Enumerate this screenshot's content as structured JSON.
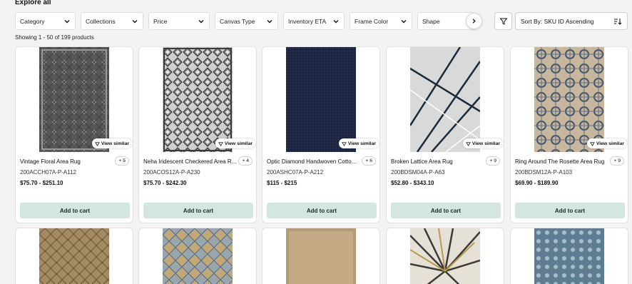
{
  "page": {
    "title": "Explore all",
    "count_text": "Showing 1 - 50 of 199 products"
  },
  "filters": [
    {
      "label": "Category",
      "name": "filter-category"
    },
    {
      "label": "Collections",
      "name": "filter-collections"
    },
    {
      "label": "Price",
      "name": "filter-price"
    },
    {
      "label": "Canvas Type",
      "name": "filter-canvas-type"
    },
    {
      "label": "Inventory ETA",
      "name": "filter-inventory-eta"
    },
    {
      "label": "Frame Color",
      "name": "filter-frame-color"
    },
    {
      "label": "Shape",
      "name": "filter-shape"
    }
  ],
  "sort": {
    "label": "Sort By: SKU ID Ascending"
  },
  "card_actions": {
    "view_similar": "View similar",
    "add_to_cart": "Add to cart"
  },
  "products": [
    {
      "name": "Vintage Floral Area Rug",
      "variants": "+ 5",
      "sku": "200ACCH07A-P-A112",
      "price": "$75.70 - $251.10"
    },
    {
      "name": "Neha Iridescent Checkered Area R...",
      "variants": "+ 4",
      "sku": "200ACOS12A-P-A230",
      "price": "$75.70 - $242.30"
    },
    {
      "name": "Optic Diamond Handwoven Cotto...",
      "variants": "+ 6",
      "sku": "200ASHC07A-P-A212",
      "price": "$115 - $215"
    },
    {
      "name": "Broken Lattice Area Rug",
      "variants": "+ 9",
      "sku": "200BDSM04A-P-A63",
      "price": "$52.80 - $343.10"
    },
    {
      "name": "Ring Around The Rosette Area Rug",
      "variants": "+ 9",
      "sku": "200BDSM12A-P-A103",
      "price": "$69.90 - $189.90"
    }
  ],
  "colors": {
    "button_bg": "#d4e7df",
    "page_bg": "#f3f3f3"
  }
}
